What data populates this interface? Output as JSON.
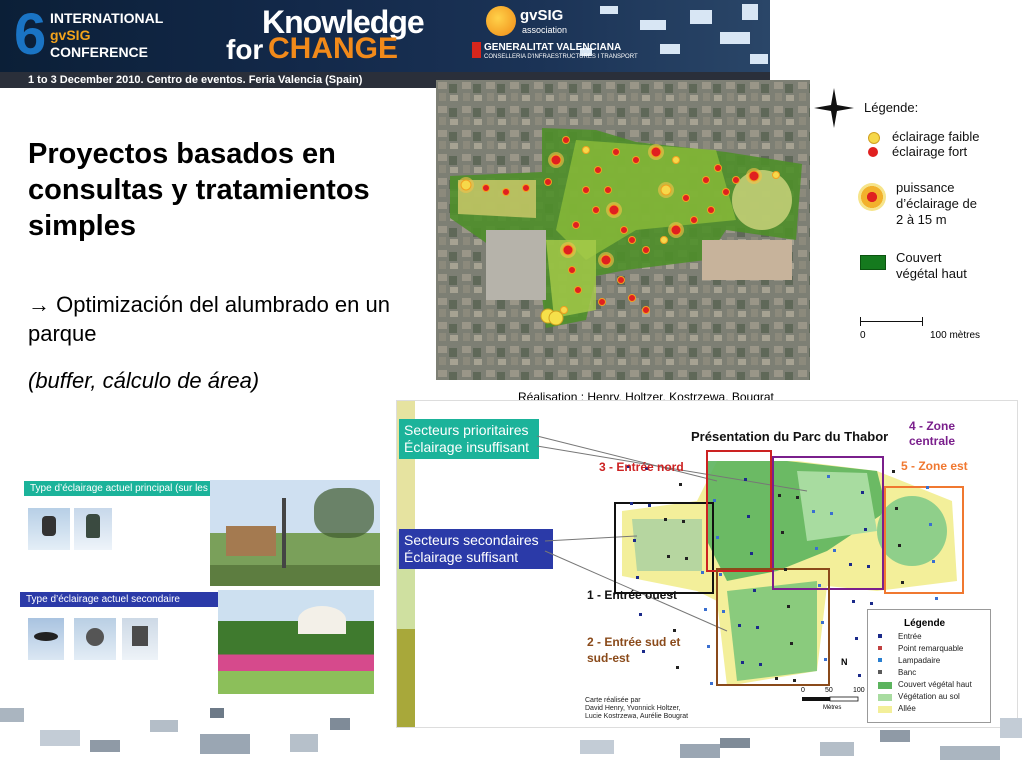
{
  "header": {
    "conference_number": "6",
    "conference_line1": "INTERNATIONAL",
    "conference_line2": "gvSIG",
    "conference_line3": "CONFERENCE",
    "slogan_line1": "Knowledge",
    "slogan_for": "for",
    "slogan_change": "CHANGE",
    "gvsig_name": "gvSIG",
    "gvsig_sub": "association",
    "generalitat": "GENERALITAT VALENCIANA",
    "generalitat_sub": "CONSELLERIA D'INFRAESTRUCTURES I TRANSPORT",
    "date_line": "1 to 3 December 2010. Centro de eventos. Feria Valencia (Spain)"
  },
  "slide": {
    "title": "Proyectos basados en consultas y tratamientos simples",
    "bullet": "→ Optimización del alumbrado en un parque",
    "subnote": "(buffer, cálculo de área)"
  },
  "map1_legend": {
    "title": "Légende:",
    "faible": "éclairage faible",
    "fort": "éclairage fort",
    "puissance": "puissance d’éclairage de 2 à 15 m",
    "couvert": "Couvert végétal haut",
    "scale_start": "0",
    "scale_end": "100 mètres"
  },
  "credit": "Réalisation : Henry, Holtzer, Kostrzewa, Bougrat",
  "photos": {
    "principal_label": "Type d’éclairage actuel principal (sur les allées)",
    "secondaire_label": "Type d’éclairage actuel secondaire"
  },
  "map2": {
    "title": "Présentation du Parc du Thabor",
    "prioritaires_line1": "Secteurs prioritaires",
    "prioritaires_line2": "Éclairage insuffisant",
    "secondaires_line1": "Secteurs secondaires",
    "secondaires_line2": "Éclairage suffisant",
    "zone1": "1 - Entrée ouest",
    "zone2_line1": "2 - Entrée sud et",
    "zone2_line2": "sud-est",
    "zone3": "3 - Entrée nord",
    "zone4_line1": "4 - Zone",
    "zone4_line2": "centrale",
    "zone5": "5 - Zone est",
    "legend_title": "Légende",
    "legend_items": [
      "Entrée",
      "Point remarquable",
      "Lampadaire",
      "Banc",
      "Couvert végétal haut",
      "Végétation au sol",
      "Allée"
    ],
    "footer_credit": "Carte réalisée par\nDavid Henry, Yvonnick Holtzer,\nLucie Kostrzewa, Aurélie Bougrat",
    "scale_0": "0",
    "scale_50": "50",
    "scale_100": "100",
    "scale_unit": "Mètres",
    "north": "N"
  },
  "colors": {
    "banner": "#13294a",
    "accent_orange": "#f28a1a",
    "teal_box": "#1bb39a",
    "blue_box": "#2b3aa8",
    "zone3_red": "#cc2222",
    "zone4_purple": "#7a1f8c",
    "zone5_orange": "#f07830",
    "zone2_brown": "#8a4a1a"
  }
}
